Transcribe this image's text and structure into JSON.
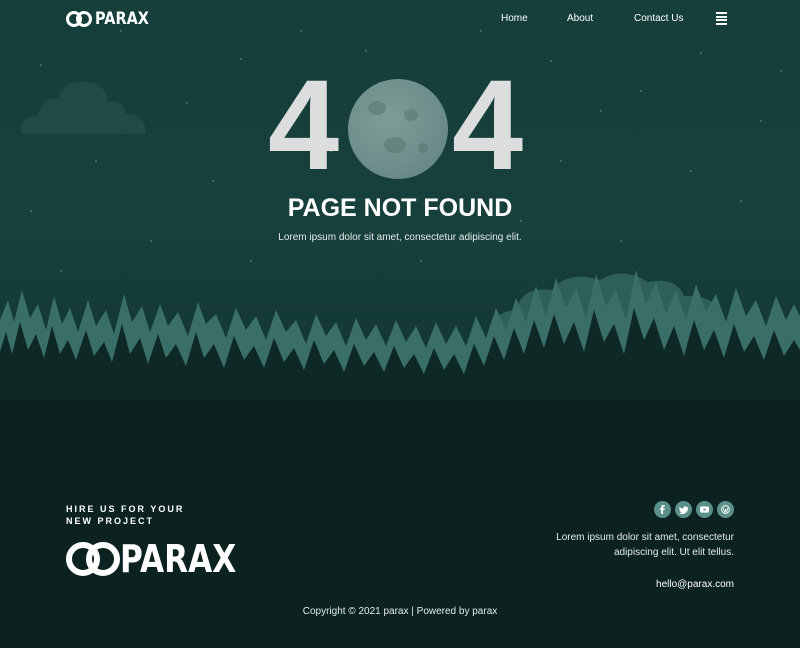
{
  "header": {
    "logo_text": "PARAX",
    "nav": [
      "Home",
      "About",
      "Contact Us"
    ],
    "menu_icon": "hamburger-menu-icon"
  },
  "hero": {
    "error_digit_left": "4",
    "error_digit_right": "4",
    "moon_icon": "moon-icon",
    "title": "PAGE NOT FOUND",
    "subtitle": "Lorem ipsum dolor sit amet, consectetur adipiscing elit."
  },
  "footer": {
    "hire_line1": "HIRE US FOR YOUR",
    "hire_line2": "NEW PROJECT",
    "logo_text": "PARAX",
    "social_icons": [
      "facebook-icon",
      "twitter-icon",
      "youtube-icon",
      "wordpress-icon"
    ],
    "address_line1": "Lorem ipsum dolor sit amet, consectetur",
    "address_line2": "adipiscing elit. Ut elit tellus.",
    "email": "hello@parax.com",
    "copyright": "Copyright © 2021 parax | Powered by parax"
  },
  "colors": {
    "hero_bg": "#173f3b",
    "footer_bg": "#0b2220",
    "tree_light": "#3a6e68",
    "tree_dark": "#0e2826",
    "social_bg": "#5a9089",
    "digit": "#dcdedd"
  }
}
